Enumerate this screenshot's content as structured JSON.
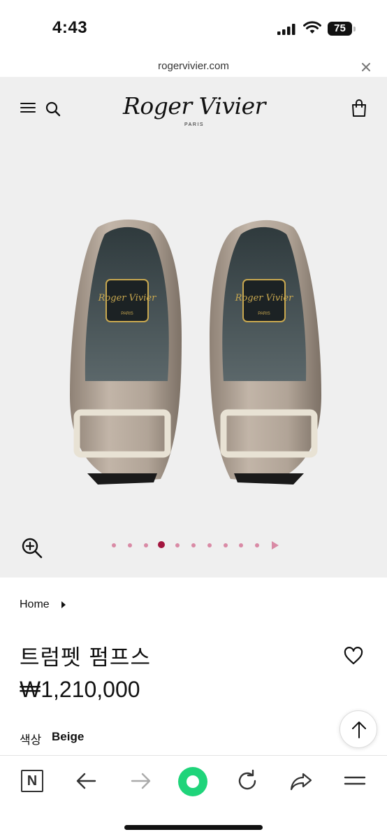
{
  "status_bar": {
    "time": "4:43",
    "battery": "75"
  },
  "browser": {
    "url": "rogervivier.com"
  },
  "header": {
    "logo_text": "Roger Vivier",
    "logo_sub": "PARIS"
  },
  "gallery": {
    "image_count": 10,
    "active_index": 3,
    "insole_brand": "Roger Vivier",
    "insole_city": "PARIS"
  },
  "breadcrumb": {
    "home": "Home"
  },
  "product": {
    "title": "트럼펫 펌프스",
    "price": "₩1,210,000",
    "color_label": "색상",
    "color_value": "Beige"
  },
  "toolbar": {
    "n_label": "N"
  },
  "colors": {
    "accent": "#a3163f",
    "dot_inactive": "#d98aa5",
    "green": "#1fd47a",
    "hero_bg": "#efefef"
  }
}
